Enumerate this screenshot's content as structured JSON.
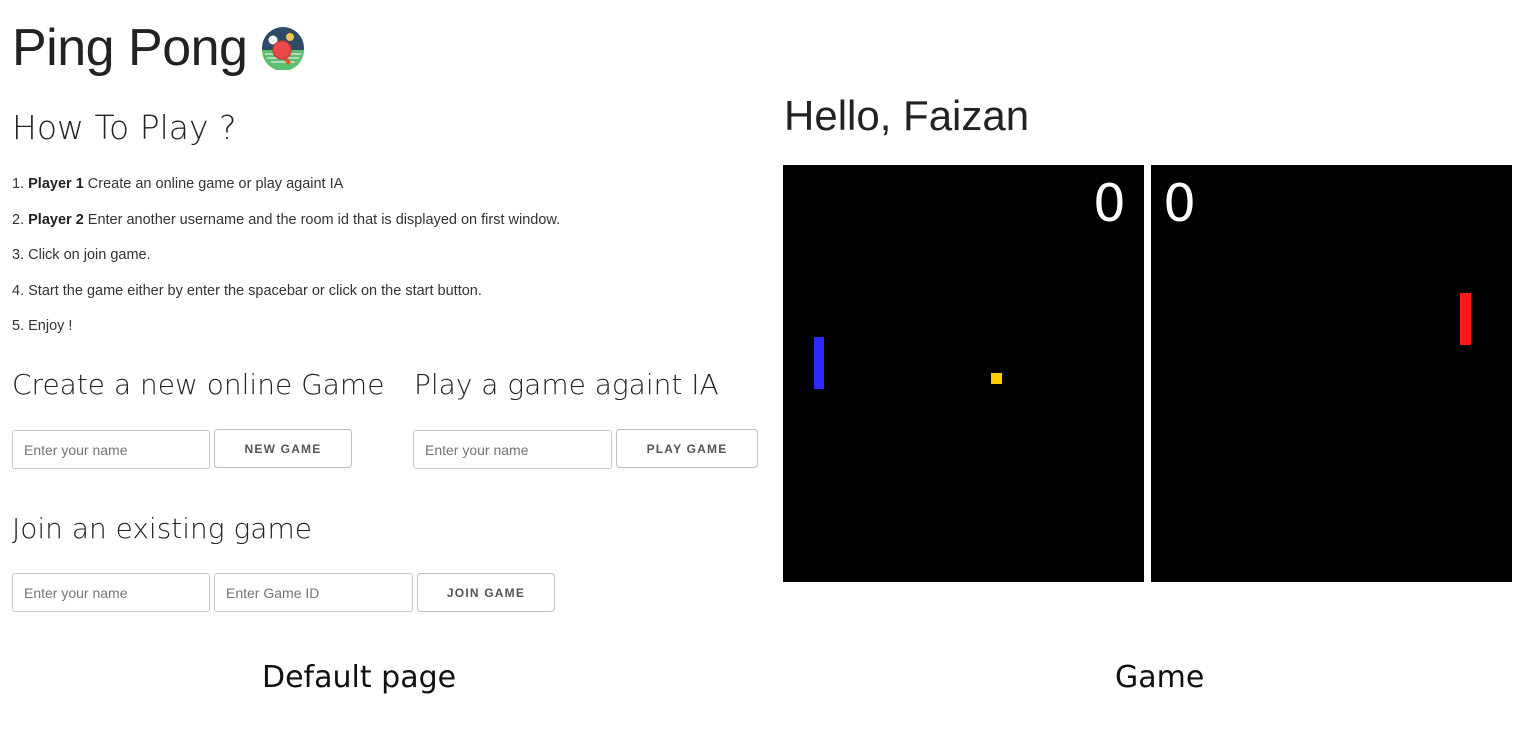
{
  "page_title": "Ping Pong",
  "logo_icon": "ping-pong-paddle-icon",
  "how_to": {
    "heading": "How To Play ?",
    "steps": [
      {
        "num": "1.",
        "bold": "Player 1",
        "text": " Create an online game or play againt IA"
      },
      {
        "num": "2.",
        "bold": "Player 2",
        "text": " Enter another username and the room id that is displayed on first window."
      },
      {
        "num": "3.",
        "bold": "",
        "text": " Click on join game."
      },
      {
        "num": "4.",
        "bold": "",
        "text": " Start the game either by enter the spacebar or click on the start button."
      },
      {
        "num": "5.",
        "bold": "",
        "text": " Enjoy !"
      }
    ]
  },
  "create": {
    "heading": "Create a new online Game",
    "name_placeholder": "Enter your name",
    "button": "NEW GAME"
  },
  "ia": {
    "heading": "Play a game againt IA",
    "name_placeholder": "Enter your name",
    "button": "PLAY GAME"
  },
  "join": {
    "heading": "Join an existing game",
    "name_placeholder": "Enter your name",
    "id_placeholder": "Enter Game ID",
    "button": "JOIN GAME"
  },
  "game": {
    "greeting": "Hello, Faizan",
    "score_left": "0",
    "score_right": "0",
    "colors": {
      "field": "#000000",
      "left_paddle": "#2b2bff",
      "right_paddle": "#ff1a1a",
      "ball": "#ffcc00"
    }
  },
  "captions": {
    "left": "Default page",
    "right": "Game"
  }
}
